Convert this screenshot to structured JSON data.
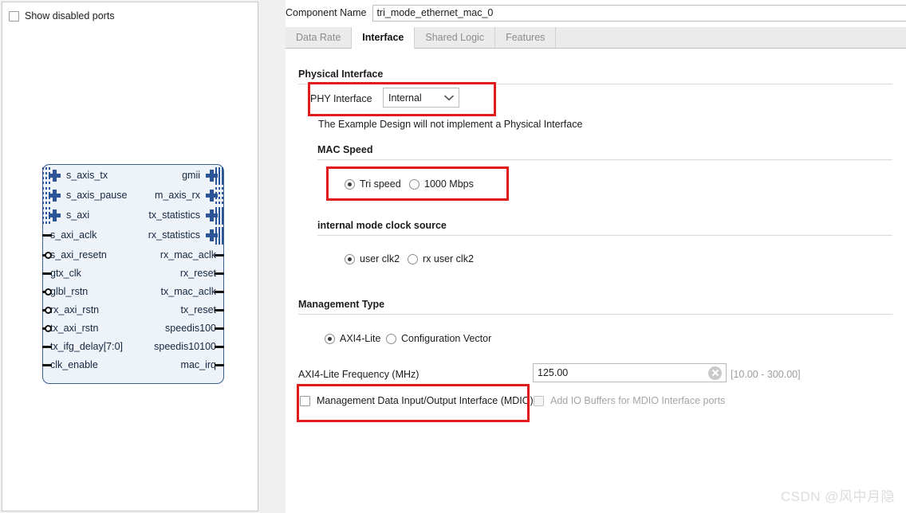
{
  "left_panel": {
    "show_disabled_ports_label": "Show disabled ports",
    "show_disabled_ports_checked": false,
    "diagram": {
      "inputs": [
        {
          "name": "s_axis_tx",
          "type": "bus"
        },
        {
          "name": "s_axis_pause",
          "type": "bus"
        },
        {
          "name": "s_axi",
          "type": "bus"
        },
        {
          "name": "s_axi_aclk",
          "type": "pin"
        },
        {
          "name": "s_axi_resetn",
          "type": "pin-inverted"
        },
        {
          "name": "gtx_clk",
          "type": "pin"
        },
        {
          "name": "glbl_rstn",
          "type": "pin-inverted"
        },
        {
          "name": "rx_axi_rstn",
          "type": "pin-inverted"
        },
        {
          "name": "tx_axi_rstn",
          "type": "pin-inverted"
        },
        {
          "name": "tx_ifg_delay[7:0]",
          "type": "pin"
        },
        {
          "name": "clk_enable",
          "type": "pin"
        }
      ],
      "outputs": [
        {
          "name": "gmii",
          "type": "bus"
        },
        {
          "name": "m_axis_rx",
          "type": "bus"
        },
        {
          "name": "tx_statistics",
          "type": "bus"
        },
        {
          "name": "rx_statistics",
          "type": "bus"
        },
        {
          "name": "rx_mac_aclk",
          "type": "pin"
        },
        {
          "name": "rx_reset",
          "type": "pin"
        },
        {
          "name": "tx_mac_aclk",
          "type": "pin"
        },
        {
          "name": "tx_reset",
          "type": "pin"
        },
        {
          "name": "speedis100",
          "type": "pin"
        },
        {
          "name": "speedis10100",
          "type": "pin"
        },
        {
          "name": "mac_irq",
          "type": "pin"
        }
      ]
    }
  },
  "header": {
    "component_name_label": "Component Name",
    "component_name_value": "tri_mode_ethernet_mac_0"
  },
  "tabs": [
    {
      "label": "Data Rate",
      "active": false
    },
    {
      "label": "Interface",
      "active": true
    },
    {
      "label": "Shared Logic",
      "active": false
    },
    {
      "label": "Features",
      "active": false
    }
  ],
  "physical_interface": {
    "title": "Physical Interface",
    "phy_label": "PHY Interface",
    "phy_value": "Internal",
    "phy_options": [
      "Internal"
    ],
    "note": "The Example Design will not implement a Physical Interface"
  },
  "mac_speed": {
    "title": "MAC Speed",
    "options": [
      {
        "label": "Tri speed",
        "selected": true
      },
      {
        "label": "1000 Mbps",
        "selected": false
      }
    ]
  },
  "clock_source": {
    "title": "internal mode clock source",
    "options": [
      {
        "label": "user clk2",
        "selected": true
      },
      {
        "label": "rx user clk2",
        "selected": false
      }
    ]
  },
  "management_type": {
    "title": "Management Type",
    "options": [
      {
        "label": "AXI4-Lite",
        "selected": true
      },
      {
        "label": "Configuration Vector",
        "selected": false
      }
    ],
    "freq_label": "AXI4-Lite Frequency (MHz)",
    "freq_value": "125.00",
    "freq_range": "[10.00 - 300.00]",
    "mdio_label": "Management Data Input/Output Interface (MDIO)",
    "mdio_checked": false,
    "io_buffers_label": "Add IO Buffers for MDIO Interface ports",
    "io_buffers_checked": false,
    "io_buffers_disabled": true
  },
  "watermark": "CSDN @风中月隐",
  "colors": {
    "highlight": "#e01b1b",
    "diagram_border": "#3a5f94",
    "diagram_fill": "#eef3fa",
    "bus_marker": "#2b5597"
  }
}
